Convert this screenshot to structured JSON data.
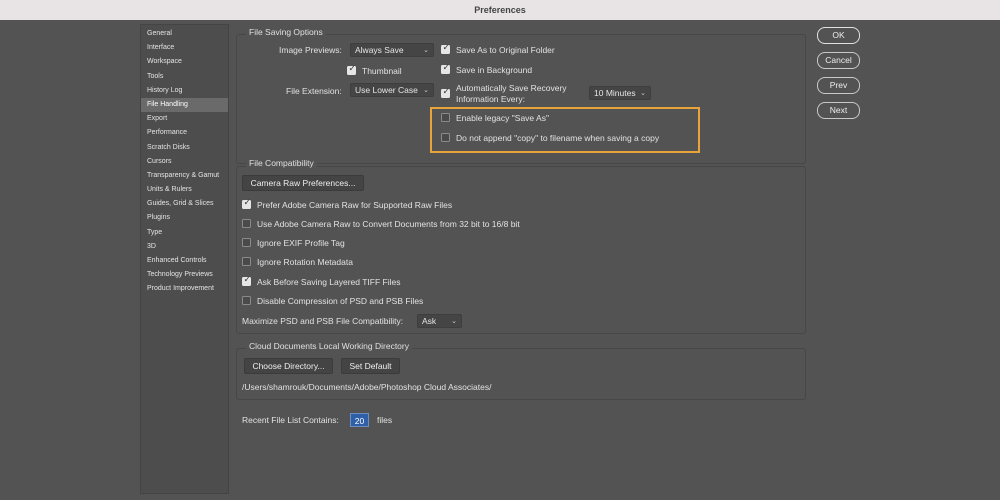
{
  "window": {
    "title": "Preferences"
  },
  "sidebar": {
    "items": [
      "General",
      "Interface",
      "Workspace",
      "Tools",
      "History Log",
      "File Handling",
      "Export",
      "Performance",
      "Scratch Disks",
      "Cursors",
      "Transparency & Gamut",
      "Units & Rulers",
      "Guides, Grid & Slices",
      "Plugins",
      "Type",
      "3D",
      "Enhanced Controls",
      "Technology Previews",
      "Product Improvement"
    ],
    "active": "File Handling"
  },
  "file_saving": {
    "title": "File Saving Options",
    "image_previews_label": "Image Previews:",
    "image_previews_value": "Always Save",
    "thumbnail_label": "Thumbnail",
    "file_extension_label": "File Extension:",
    "file_extension_value": "Use Lower Case",
    "save_as_original_label": "Save As to Original Folder",
    "save_background_label": "Save in Background",
    "auto_save_label_1": "Automatically Save Recovery",
    "auto_save_label_2": "Information Every:",
    "auto_save_value": "10 Minutes",
    "legacy_save_as_label": "Enable legacy \"Save As\"",
    "no_copy_label": "Do not append \"copy\" to filename when saving a copy"
  },
  "file_compat": {
    "title": "File Compatibility",
    "camera_raw_button": "Camera Raw Preferences...",
    "prefer_acr_label": "Prefer Adobe Camera Raw for Supported Raw Files",
    "use_acr_label": "Use Adobe Camera Raw to Convert Documents from 32 bit to 16/8 bit",
    "ignore_exif_label": "Ignore EXIF Profile Tag",
    "ignore_rotation_label": "Ignore Rotation Metadata",
    "ask_tiff_label": "Ask Before Saving Layered TIFF Files",
    "disable_compression_label": "Disable Compression of PSD and PSB Files",
    "maximize_label": "Maximize PSD and PSB File Compatibility:",
    "maximize_value": "Ask"
  },
  "cloud": {
    "title": "Cloud Documents Local Working Directory",
    "choose_button": "Choose Directory...",
    "default_button": "Set Default",
    "path": "/Users/shamrouk/Documents/Adobe/Photoshop Cloud Associates/"
  },
  "recent": {
    "label": "Recent File List Contains:",
    "value": "20",
    "suffix": "files"
  },
  "buttons": {
    "ok": "OK",
    "cancel": "Cancel",
    "prev": "Prev",
    "next": "Next"
  },
  "colors": {
    "panel": "#535353",
    "highlight": "#e8a33a",
    "field_focus": "#2f5fa6"
  }
}
